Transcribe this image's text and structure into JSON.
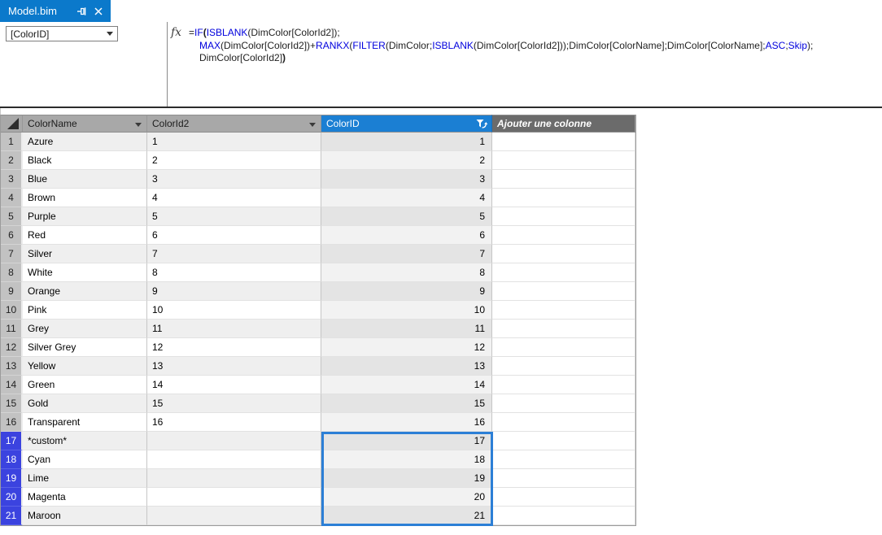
{
  "window": {
    "tab_title": "Model.bim"
  },
  "formula_bar": {
    "name_box_value": "[ColorID]",
    "fx_label": "fx",
    "lines": [
      {
        "indent": 0,
        "tokens": [
          [
            "=",
            "p"
          ],
          [
            "IF",
            "f"
          ],
          [
            "(",
            "pb"
          ],
          [
            "ISBLANK",
            "f"
          ],
          [
            "(DimColor[ColorId2]);",
            "p"
          ]
        ]
      },
      {
        "indent": 1,
        "tokens": [
          [
            "MAX",
            "f"
          ],
          [
            "(DimColor[ColorId2])+",
            "p"
          ],
          [
            "RANKX",
            "f"
          ],
          [
            "(",
            "p"
          ],
          [
            "FILTER",
            "f"
          ],
          [
            "(DimColor;",
            "p"
          ],
          [
            "ISBLANK",
            "f"
          ],
          [
            "(DimColor[ColorId2]));DimColor[ColorName];DimColor[ColorName];",
            "p"
          ],
          [
            "ASC",
            "f"
          ],
          [
            ";",
            "p"
          ],
          [
            "Skip",
            "f"
          ],
          [
            ");",
            "p"
          ]
        ]
      },
      {
        "indent": 1,
        "tokens": [
          [
            "DimColor[ColorId2]",
            "p"
          ],
          [
            ")",
            "pb"
          ]
        ]
      }
    ]
  },
  "grid": {
    "columns": [
      {
        "key": "name",
        "label": "ColorName",
        "has_dropdown": true
      },
      {
        "key": "id2",
        "label": "ColorId2",
        "has_dropdown": true
      },
      {
        "key": "id",
        "label": "ColorID",
        "selected": true,
        "icon": "filter-sort-icon"
      },
      {
        "key": "add",
        "label": "Ajouter une colonne",
        "add_column": true
      }
    ],
    "rows": [
      {
        "n": "1",
        "name": "Azure",
        "id2": "1",
        "id": "1"
      },
      {
        "n": "2",
        "name": "Black",
        "id2": "2",
        "id": "2"
      },
      {
        "n": "3",
        "name": "Blue",
        "id2": "3",
        "id": "3"
      },
      {
        "n": "4",
        "name": "Brown",
        "id2": "4",
        "id": "4"
      },
      {
        "n": "5",
        "name": "Purple",
        "id2": "5",
        "id": "5"
      },
      {
        "n": "6",
        "name": "Red",
        "id2": "6",
        "id": "6"
      },
      {
        "n": "7",
        "name": "Silver",
        "id2": "7",
        "id": "7"
      },
      {
        "n": "8",
        "name": "White",
        "id2": "8",
        "id": "8"
      },
      {
        "n": "9",
        "name": "Orange",
        "id2": "9",
        "id": "9"
      },
      {
        "n": "10",
        "name": "Pink",
        "id2": "10",
        "id": "10"
      },
      {
        "n": "11",
        "name": "Grey",
        "id2": "11",
        "id": "11"
      },
      {
        "n": "12",
        "name": "Silver Grey",
        "id2": "12",
        "id": "12"
      },
      {
        "n": "13",
        "name": "Yellow",
        "id2": "13",
        "id": "13"
      },
      {
        "n": "14",
        "name": "Green",
        "id2": "14",
        "id": "14"
      },
      {
        "n": "15",
        "name": "Gold",
        "id2": "15",
        "id": "15"
      },
      {
        "n": "16",
        "name": "Transparent",
        "id2": "16",
        "id": "16"
      },
      {
        "n": "17",
        "name": "*custom*",
        "id2": "",
        "id": "17",
        "selected": true
      },
      {
        "n": "18",
        "name": "Cyan",
        "id2": "",
        "id": "18",
        "selected": true
      },
      {
        "n": "19",
        "name": "Lime",
        "id2": "",
        "id": "19",
        "selected": true
      },
      {
        "n": "20",
        "name": "Magenta",
        "id2": "",
        "id": "20",
        "selected": true
      },
      {
        "n": "21",
        "name": "Maroon",
        "id2": "",
        "id": "21",
        "selected": true
      }
    ],
    "selected_column": "ColorID",
    "selected_row_numbers": [
      "17",
      "18",
      "19",
      "20",
      "21"
    ]
  },
  "colors": {
    "tab_blue": "#0b79cb",
    "selected_header_blue": "#1b7fd3",
    "selected_row_blue": "#3b43df",
    "selection_border_blue": "#2c7fd6",
    "keyword_blue": "#0000dd",
    "header_gray": "#a8a8a8",
    "add_column_header_gray": "#6b6b6b",
    "row_header_gray": "#c2c2c2"
  }
}
